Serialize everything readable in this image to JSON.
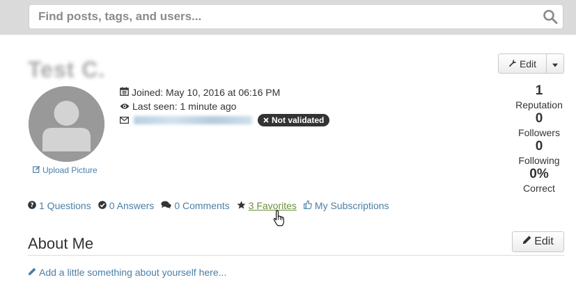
{
  "search": {
    "placeholder": "Find posts, tags, and users..."
  },
  "profile": {
    "username": "Test C.",
    "edit_label": "Edit",
    "upload_label": "Upload Picture",
    "joined": "Joined: May 10, 2016 at 06:16 PM",
    "last_seen": "Last seen: 1 minute ago",
    "email": "redacted@example.com",
    "badge": "Not validated"
  },
  "stats": [
    {
      "value": "1",
      "label": "Reputation"
    },
    {
      "value": "0",
      "label": "Followers"
    },
    {
      "value": "0",
      "label": "Following"
    },
    {
      "value": "0%",
      "label": "Correct"
    }
  ],
  "tabs": [
    {
      "label": "1 Questions",
      "icon": "question-circle-icon"
    },
    {
      "label": "0 Answers",
      "icon": "check-circle-icon"
    },
    {
      "label": "0 Comments",
      "icon": "comments-icon"
    },
    {
      "label": "3 Favorites",
      "icon": "star-icon",
      "active": true
    },
    {
      "label": "My Subscriptions",
      "icon": "thumbs-up-icon"
    }
  ],
  "about": {
    "title": "About Me",
    "edit_label": "Edit",
    "add_text": "Add a little something about yourself here..."
  },
  "colors": {
    "link": "#4a7fa5",
    "active_tab": "#6a8f3a",
    "badge_bg": "#333333"
  }
}
